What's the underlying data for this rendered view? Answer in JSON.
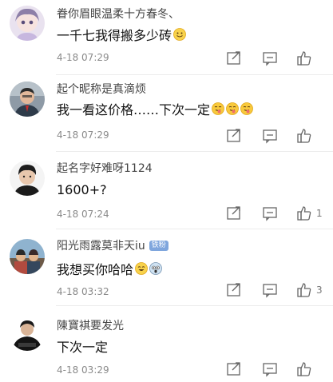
{
  "comments": [
    {
      "name": "眷你眉眼温柔十方春冬、",
      "text": "一千七我得搬多少砖",
      "emojis": [
        "smile-emoji"
      ],
      "time": "4-18 07:29",
      "likes": "",
      "badge": ""
    },
    {
      "name": "起个昵称是真滴烦",
      "text": "我一看这价格……下次一定",
      "emojis": [
        "tongue-emoji",
        "tongue-emoji",
        "tongue-emoji"
      ],
      "time": "4-18 07:29",
      "likes": "",
      "badge": ""
    },
    {
      "name": "起名字好难呀1124",
      "text": "1600+?",
      "emojis": [],
      "time": "4-18 07:24",
      "likes": "1",
      "badge": ""
    },
    {
      "name": "阳光雨露莫非天iu",
      "text": "我想买你哈哈",
      "emojis": [
        "grin-emoji",
        "shock-emoji"
      ],
      "time": "4-18 03:32",
      "likes": "3",
      "badge": "铁粉"
    },
    {
      "name": "陳寶褀要发光",
      "text": "下次一定",
      "emojis": [],
      "time": "4-18 03:29",
      "likes": "",
      "badge": ""
    }
  ],
  "icons": {
    "share": "share-icon",
    "reply": "comment-icon",
    "like": "thumbs-up-icon"
  }
}
